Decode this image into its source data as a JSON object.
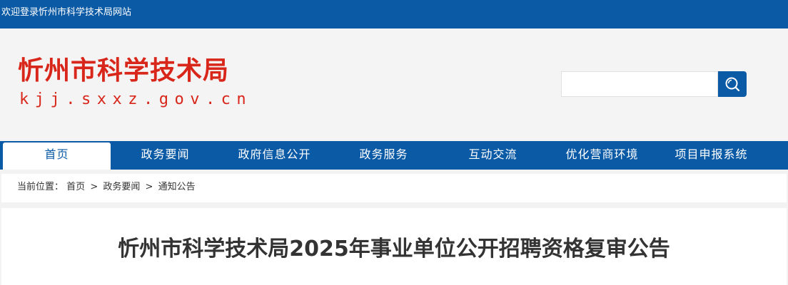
{
  "topbar": {
    "welcome": "欢迎登录忻州市科学技术局网站"
  },
  "header": {
    "logo_title": "忻州市科学技术局",
    "logo_domain": "kjj.sxxz.gov.cn",
    "search": {
      "value": "",
      "placeholder": "",
      "icon": "search-icon"
    }
  },
  "nav": {
    "items": [
      {
        "label": "首页",
        "active": true
      },
      {
        "label": "政务要闻"
      },
      {
        "label": "政府信息公开"
      },
      {
        "label": "政务服务"
      },
      {
        "label": "互动交流"
      },
      {
        "label": "优化营商环境"
      },
      {
        "label": "项目申报系统"
      }
    ]
  },
  "breadcrumb": {
    "prefix": "当前位置：",
    "items": [
      "首页",
      "政务要闻",
      "通知公告"
    ],
    "separator": ">"
  },
  "article": {
    "title": "忻州市科学技术局2025年事业单位公开招聘资格复审公告"
  },
  "colors": {
    "brand_blue": "#0b5aa6",
    "logo_red": "#d8261a",
    "page_bg": "#f3f3f3"
  }
}
